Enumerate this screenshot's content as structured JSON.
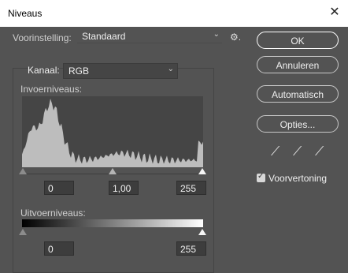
{
  "window": {
    "title": "Niveaus",
    "close_glyph": "✕"
  },
  "preset": {
    "label": "Voorinstelling:",
    "value": "Standaard",
    "chevron": "⌄",
    "gear_glyph": "⚙."
  },
  "channel": {
    "label": "Kanaal:",
    "value": "RGB",
    "chevron": "⌄"
  },
  "input_levels": {
    "label": "Invoerniveaus:",
    "black": "0",
    "gamma": "1,00",
    "white": "255"
  },
  "output_levels": {
    "label": "Uitvoerniveaus:",
    "black": "0",
    "white": "255"
  },
  "buttons": {
    "ok": "OK",
    "cancel": "Annuleren",
    "auto": "Automatisch",
    "options": "Opties..."
  },
  "eyedroppers": {
    "black": "⟋",
    "gray": "⟋",
    "white": "⟋"
  },
  "preview": {
    "label": "Voorvertoning",
    "checked": true,
    "check_glyph": "✓"
  },
  "colors": {
    "background": "#535353",
    "histogram_fill": "#bdbdbd",
    "histogram_bg": "#454545"
  }
}
